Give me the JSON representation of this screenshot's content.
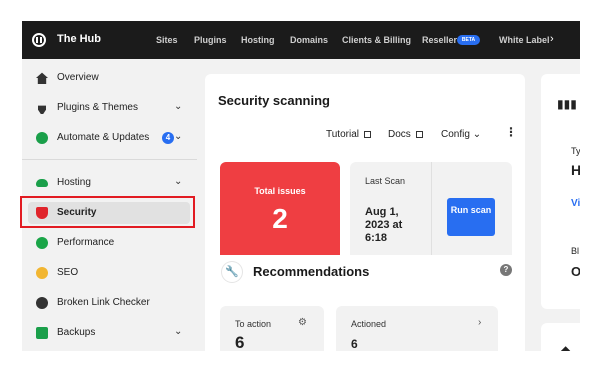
{
  "app": {
    "title": "The Hub"
  },
  "topnav": [
    {
      "label": "Sites"
    },
    {
      "label": "Plugins"
    },
    {
      "label": "Hosting"
    },
    {
      "label": "Domains"
    },
    {
      "label": "Clients & Billing"
    },
    {
      "label": "Reseller"
    },
    {
      "label": "White Label"
    }
  ],
  "beta_badge": "BETA",
  "nav_more_icon": "chevron-right-icon",
  "sidebar": {
    "items": [
      {
        "label": "Overview",
        "icon": "house-icon"
      },
      {
        "label": "Plugins & Themes",
        "icon": "plug-icon"
      },
      {
        "label": "Automate & Updates",
        "icon": "automate-icon",
        "badge": "4"
      },
      {
        "label": "Hosting",
        "icon": "cloud-icon"
      },
      {
        "label": "Security",
        "icon": "shield-icon"
      },
      {
        "label": "Performance",
        "icon": "performance-icon"
      },
      {
        "label": "SEO",
        "icon": "seo-icon"
      },
      {
        "label": "Broken Link Checker",
        "icon": "link-checker-icon"
      },
      {
        "label": "Backups",
        "icon": "backups-icon"
      }
    ]
  },
  "main": {
    "title": "Security scanning",
    "toolbar": {
      "tutorial": "Tutorial",
      "docs": "Docs",
      "config": "Config",
      "config_caret": "⌄",
      "more": "⋮"
    },
    "issues": {
      "label": "Total issues",
      "count": "2"
    },
    "last_scan": {
      "label": "Last Scan",
      "date": "Aug 1, 2023 at 6:18",
      "run_button": "Run scan"
    },
    "recommendations": {
      "title": "Recommendations",
      "help": "?",
      "to_action": {
        "label": "To action",
        "count": "6"
      },
      "actioned": {
        "label": "Actioned",
        "count": "6"
      }
    }
  },
  "right_cards": {
    "text_1": "Ty",
    "text_2": "H",
    "text_3": "Vi",
    "text_4": "Bl",
    "text_5": "O"
  },
  "colors": {
    "accent": "#286ef1",
    "danger": "#ef3e42",
    "success": "#1a9f4a",
    "highlight": "#e21b22"
  }
}
